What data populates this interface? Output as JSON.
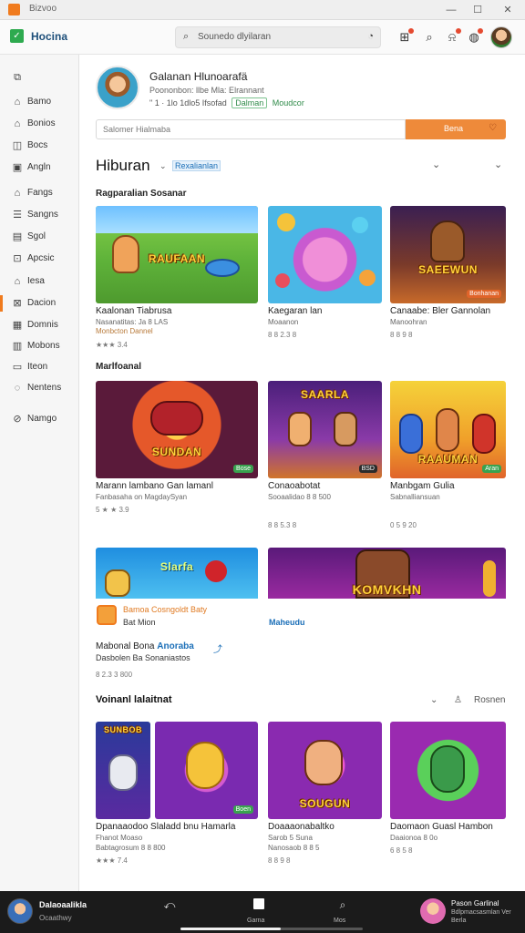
{
  "window": {
    "title": "Bizvoo",
    "controls": [
      "—",
      "☐",
      "✕"
    ]
  },
  "appbar": {
    "app_name": "Hocina",
    "search_placeholder": "Sounedo dlyilaran",
    "icons": [
      "cart-icon",
      "search-icon",
      "bell-icon",
      "notification-icon",
      "avatar"
    ]
  },
  "sidebar": {
    "items": [
      {
        "label": "",
        "icon": "⧉"
      },
      {
        "label": "Bamo",
        "icon": "⌂"
      },
      {
        "label": "Bonios",
        "icon": "⌂"
      },
      {
        "label": "Bocs",
        "icon": "◫"
      },
      {
        "label": "Angln",
        "icon": "▣"
      },
      {
        "label": "Fangs",
        "icon": "⌂"
      },
      {
        "label": "Sangns",
        "icon": "☰"
      },
      {
        "label": "Sgol",
        "icon": "▤"
      },
      {
        "label": "Apcsic",
        "icon": "⊡"
      },
      {
        "label": "Iesa",
        "icon": "⌂"
      },
      {
        "label": "Dacion",
        "icon": "⊠"
      },
      {
        "label": "Domnis",
        "icon": "▦"
      },
      {
        "label": "Mobons",
        "icon": "▥"
      },
      {
        "label": "Iteon",
        "icon": "▭"
      },
      {
        "label": "Nentens",
        "icon": "◌"
      },
      {
        "label": "Namgo",
        "icon": "⊘"
      }
    ]
  },
  "profile": {
    "name": "Galanan Hlunoarafä",
    "meta": "Poononbon: llbe  Mla: Elrannant",
    "stats": "\"  1 ·  1lo 1dlo5 Ifsofad",
    "chip_outline": "Dalman",
    "chip_plain": "Moudcor"
  },
  "input": {
    "placeholder": "Salomer Hialmaba",
    "button_label": "Bena"
  },
  "section": {
    "title": "Hiburan",
    "tag": "Rexalianlan"
  },
  "group1": {
    "title": "Ragparalian Sosanar",
    "cards": [
      {
        "art": "RAUFAAN",
        "title": "Kaalonan Tiabrusa",
        "sub": "Nasanatitas: Ja 8 LAS",
        "sub2": "Monbcton Dannel",
        "rating": "★★★ 3.4"
      },
      {
        "art": "",
        "title": "Kaegaran lan",
        "sub": "Moaanon",
        "sub2": "",
        "rating": "8 8 2.3 8"
      },
      {
        "art": "SAEEWUN",
        "title": "Canaabe: Bler Gannolan",
        "sub": "Manoohran",
        "sub2": "",
        "rating": "8 8 9 8",
        "badge": "Bonhanan"
      }
    ]
  },
  "group2": {
    "title": "Marlfoanal",
    "cards": [
      {
        "art": "SUNDAN",
        "title": "Marann lambano Gan lamanl",
        "sub": "Fanbasaha on MagdaySyan",
        "sub2": "",
        "rating": "5 ★ ★ 3.9",
        "badge": "Bose"
      },
      {
        "art": "SAARLA",
        "title": "Conaoabotat",
        "sub": "Sooaalidao 8 8 500",
        "sub2": "",
        "rating": "8 8 5.3 8",
        "badge": "BSD"
      },
      {
        "art": "RAAUMAN",
        "title": "Manbgam Gulia",
        "sub": "Sabnalliansuan",
        "sub2": "",
        "rating": "0 5 9 20",
        "badge": "Aran"
      }
    ]
  },
  "banners": [
    {
      "art": "Slarfa"
    },
    {
      "art": "KOMVKHN"
    }
  ],
  "ad": {
    "title": "Bamoa Cosngoldt Baty",
    "sub": "Bat Mion",
    "link": "Maheudu"
  },
  "promo": {
    "title_plain": "Mabonal  Bona",
    "title_link": "Anoraba",
    "sub": "Dasbolen  Ba  Sonaniastos",
    "rating": "8 2.3 3 800"
  },
  "group3": {
    "title": "Voinanl lalaitnat",
    "ctrl_label": "Rosnen",
    "cards": [
      {
        "art": "SUNBOB",
        "title": "Dpanaaodoo Slaladd bnu Hamarla",
        "sub": "Fhanot Moaso",
        "sub2": "Babtagrosum 8 8 800",
        "rating": "★★★ 7.4",
        "badge": "Boen"
      },
      {
        "art": "SOUGUN",
        "title": "Doaaaonabaltko",
        "sub": "Sarob 5 Suna",
        "sub2": "Nanosaob 8 8 5",
        "rating": "8 8 9 8"
      },
      {
        "art": "",
        "title": "Daomaon Guasl Hambon",
        "sub": "Daaionoa 8 0o",
        "sub2": "",
        "rating": "6 8 5 8"
      }
    ]
  },
  "player": {
    "title": "Dalaoaalikla",
    "sub": "Ocaathwy",
    "ctrl_labels": [
      "",
      "Garna",
      "Mos"
    ],
    "progress": 0.55,
    "right_title": "Pason Garlinal",
    "right_sub": "Bdlpmacsasmlan Ver Berla"
  }
}
